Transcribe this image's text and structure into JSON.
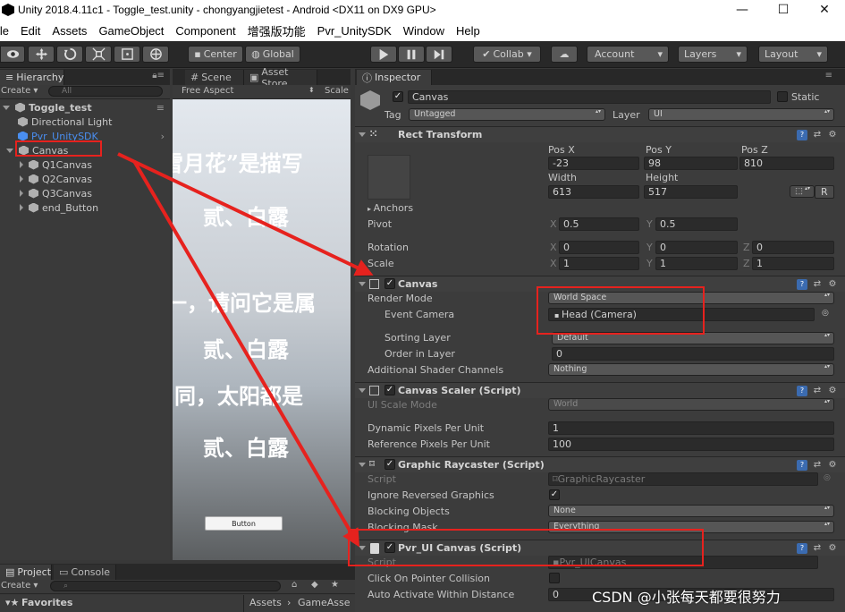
{
  "window": {
    "title": "Unity 2018.4.11c1 - Toggle_test.unity - chongyangjietest - Android <DX11 on DX9 GPU>",
    "minimize": "—",
    "maximize": "☐",
    "close": "✕"
  },
  "menu": [
    "ile",
    "Edit",
    "Assets",
    "GameObject",
    "Component",
    "增强版功能",
    "Pvr_UnitySDK",
    "Window",
    "Help"
  ],
  "toolbar": {
    "center": "Center",
    "global": "Global",
    "collab": "Collab ▾",
    "account": "Account",
    "layers": "Layers",
    "layout": "Layout"
  },
  "hierarchy": {
    "tab": "Hierarchy",
    "create": "Create ▾",
    "search": "All",
    "scene": "Toggle_test",
    "items": [
      {
        "label": "Directional Light"
      },
      {
        "label": "Pvr_UnitySDK"
      },
      {
        "label": "Canvas"
      },
      {
        "label": "Q1Canvas"
      },
      {
        "label": "Q2Canvas"
      },
      {
        "label": "Q3Canvas"
      },
      {
        "label": "end_Button"
      }
    ]
  },
  "scene_tabs": {
    "scene": "Scene",
    "asset_store": "Asset Store",
    "aspect": "Free Aspect",
    "scale": "Scale"
  },
  "game": {
    "lines": [
      "雪月花”是描写",
      "贰、白露",
      "一，请问它是属",
      "贰、白露",
      "同，太阳都是",
      "贰、白露"
    ],
    "button": "Button"
  },
  "bottom": {
    "project": "Project",
    "console": "Console",
    "create": "Create ▾",
    "favorites": "Favorites",
    "assets": "Assets",
    "gameasset": "GameAsse"
  },
  "inspector": {
    "tab": "Inspector",
    "name": "Canvas",
    "static": "Static",
    "tag_label": "Tag",
    "tag": "Untagged",
    "layer_label": "Layer",
    "layer": "UI",
    "rect": {
      "title": "Rect Transform",
      "posx_label": "Pos X",
      "posy_label": "Pos Y",
      "posz_label": "Pos Z",
      "posx": "-23",
      "posy": "98",
      "posz": "810",
      "width_label": "Width",
      "height_label": "Height",
      "width": "613",
      "height": "517",
      "anchors": "Anchors",
      "pivot": "Pivot",
      "pivot_x": "0.5",
      "pivot_y": "0.5",
      "rotation": "Rotation",
      "rot_x": "0",
      "rot_y": "0",
      "rot_z": "0",
      "scale": "Scale",
      "scale_x": "1",
      "scale_y": "1",
      "scale_z": "1",
      "x": "X",
      "y": "Y",
      "z": "Z",
      "r": "R"
    },
    "canvas": {
      "title": "Canvas",
      "render_mode_label": "Render Mode",
      "render_mode": "World Space",
      "event_camera_label": "Event Camera",
      "event_camera": "Head (Camera)",
      "sorting_layer_label": "Sorting Layer",
      "sorting_layer": "Default",
      "order_label": "Order in Layer",
      "order": "0",
      "shader_label": "Additional Shader Channels",
      "shader": "Nothing"
    },
    "scaler": {
      "title": "Canvas Scaler (Script)",
      "ui_scale_label": "UI Scale Mode",
      "ui_scale": "World",
      "dyn_label": "Dynamic Pixels Per Unit",
      "dyn": "1",
      "ref_label": "Reference Pixels Per Unit",
      "ref": "100"
    },
    "raycaster": {
      "title": "Graphic Raycaster (Script)",
      "script_label": "Script",
      "script": "GraphicRaycaster",
      "ignore_label": "Ignore Reversed Graphics",
      "blocking_label": "Blocking Objects",
      "blocking": "None",
      "mask_label": "Blocking Mask",
      "mask": "Everything"
    },
    "pvr": {
      "title": "Pvr_UI Canvas (Script)",
      "script_label": "Script",
      "script": "Pvr_UICanvas",
      "click_label": "Click On Pointer Collision",
      "auto_label": "Auto Activate Within Distance",
      "auto": "0"
    }
  },
  "watermark": "CSDN @小张每天都要很努力",
  "annotation_color": "#e6221e"
}
